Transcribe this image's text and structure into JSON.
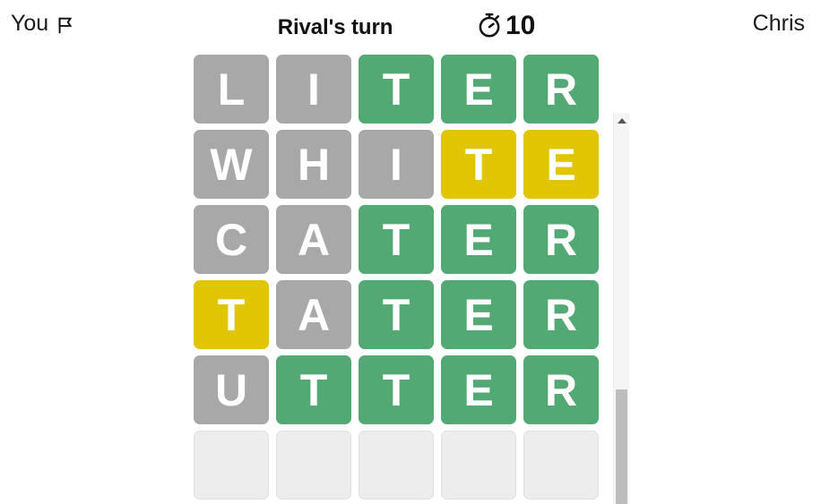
{
  "header": {
    "left_player": "You",
    "left_player_icon": "flag-icon",
    "turn_status": "Rival's turn",
    "timer_icon": "stopwatch-icon",
    "timer_value": "10",
    "right_player": "Chris"
  },
  "colors": {
    "correct": "#53a973",
    "present": "#e1c500",
    "absent": "#a8a8a8",
    "empty": "#ededed",
    "letter": "#ffffff",
    "text": "#111111",
    "scrollbar_thumb": "#bdbdbd",
    "scrollbar_track": "#f5f5f5"
  },
  "board": {
    "rows": [
      {
        "word": "LITER",
        "tiles": [
          {
            "letter": "L",
            "state": "absent"
          },
          {
            "letter": "I",
            "state": "absent"
          },
          {
            "letter": "T",
            "state": "correct"
          },
          {
            "letter": "E",
            "state": "correct"
          },
          {
            "letter": "R",
            "state": "correct"
          }
        ]
      },
      {
        "word": "WHITE",
        "tiles": [
          {
            "letter": "W",
            "state": "absent"
          },
          {
            "letter": "H",
            "state": "absent"
          },
          {
            "letter": "I",
            "state": "absent"
          },
          {
            "letter": "T",
            "state": "present"
          },
          {
            "letter": "E",
            "state": "present"
          }
        ]
      },
      {
        "word": "CATER",
        "tiles": [
          {
            "letter": "C",
            "state": "absent"
          },
          {
            "letter": "A",
            "state": "absent"
          },
          {
            "letter": "T",
            "state": "correct"
          },
          {
            "letter": "E",
            "state": "correct"
          },
          {
            "letter": "R",
            "state": "correct"
          }
        ]
      },
      {
        "word": "TATER",
        "tiles": [
          {
            "letter": "T",
            "state": "present"
          },
          {
            "letter": "A",
            "state": "absent"
          },
          {
            "letter": "T",
            "state": "correct"
          },
          {
            "letter": "E",
            "state": "correct"
          },
          {
            "letter": "R",
            "state": "correct"
          }
        ]
      },
      {
        "word": "UTTER",
        "tiles": [
          {
            "letter": "U",
            "state": "absent"
          },
          {
            "letter": "T",
            "state": "correct"
          },
          {
            "letter": "T",
            "state": "correct"
          },
          {
            "letter": "E",
            "state": "correct"
          },
          {
            "letter": "R",
            "state": "correct"
          }
        ]
      },
      {
        "word": "",
        "tiles": [
          {
            "letter": "",
            "state": "empty"
          },
          {
            "letter": "",
            "state": "empty"
          },
          {
            "letter": "",
            "state": "empty"
          },
          {
            "letter": "",
            "state": "empty"
          },
          {
            "letter": "",
            "state": "empty"
          }
        ]
      }
    ]
  },
  "scrollbar": {
    "up_arrow_icon": "chevron-up-icon"
  }
}
